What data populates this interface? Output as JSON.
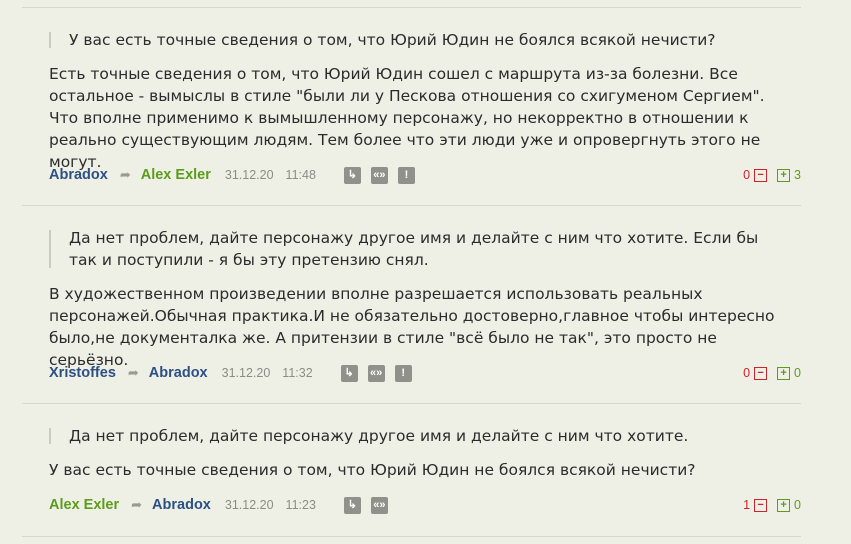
{
  "comments": [
    {
      "quote": "У вас есть точные сведения о том, что Юрий Юдин не боялся всякой нечисти?",
      "body": "Есть точные сведения о том, что Юрий Юдин сошел с маршрута из-за болезни. Все остальное - вымыслы в стиле \"были ли у Пескова отношения со схигуменом Сергием\". Что вполне применимо к вымышленному персонажу, но некорректно в отношении к реально существующим людям. Тем более что эти люди уже и опровергнуть этого не могут.",
      "author": "Abradox",
      "reply_to": "Alex Exler",
      "date": "31.12.20",
      "time": "11:48",
      "votes_down": "0",
      "votes_up": "3"
    },
    {
      "quote": "Да нет проблем, дайте персонажу другое имя и делайте с ним что хотите. Если бы так и поступили - я бы эту претензию снял.",
      "body": "В художественном произведении вполне разрешается использовать реальных персонажей.Обычная практика.И не обязательно достоверно,главное чтобы интересно было,не документалка же. А притензии в стиле \"всё было не так\", это просто не серьёзно.",
      "author": "Xristoffes",
      "reply_to": "Abradox",
      "date": "31.12.20",
      "time": "11:32",
      "votes_down": "0",
      "votes_up": "0"
    },
    {
      "quote": "Да нет проблем, дайте персонажу другое имя и делайте с ним что хотите.",
      "body": "У вас есть точные сведения о том, что Юрий Юдин не боялся всякой нечисти?",
      "author": "Alex Exler",
      "reply_to": "Abradox",
      "date": "31.12.20",
      "time": "11:23",
      "votes_down": "1",
      "votes_up": "0"
    }
  ],
  "icons": {
    "reply_arrow": "reply-arrow-icon",
    "reply": "reply-icon",
    "quote": "quote-icon",
    "report": "report-icon",
    "vote_minus": "minus-icon",
    "vote_plus": "plus-icon"
  },
  "colors": {
    "author_blue": "#2c4f85",
    "author_green": "#5c9c1a",
    "negative": "#c8252c",
    "positive": "#5c9c1a",
    "background": "#eef0e6"
  }
}
